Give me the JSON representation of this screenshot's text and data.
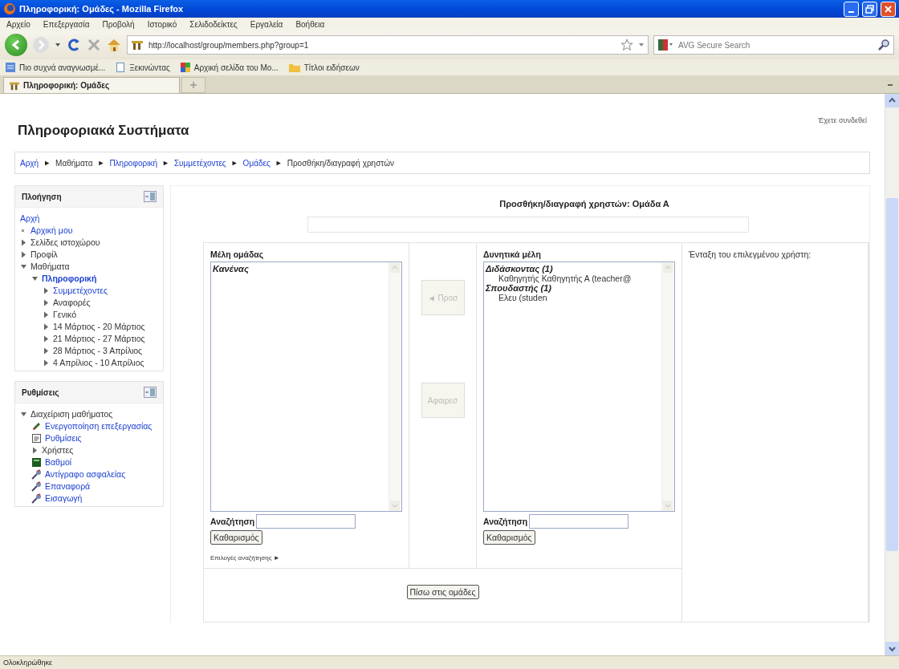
{
  "window": {
    "title": "Πληροφορική: Ομάδες - Mozilla Firefox"
  },
  "menu": [
    "Αρχείο",
    "Επεξεργασία",
    "Προβολή",
    "Ιστορικό",
    "Σελιδοδείκτες",
    "Εργαλεία",
    "Βοήθεια"
  ],
  "address_bar": {
    "value": "http://localhost/group/members.php?group=1"
  },
  "search": {
    "placeholder": "AVG Secure Search"
  },
  "bookmarks": [
    {
      "label": "Πιο συχνά αναγνωσμέ...",
      "kind": "smart"
    },
    {
      "label": "Ξεκινώντας",
      "kind": "page"
    },
    {
      "label": "Αρχική σελίδα του Mo...",
      "kind": "tiles"
    },
    {
      "label": "Τίτλοι ειδήσεων",
      "kind": "folder"
    }
  ],
  "tabs": [
    {
      "label": "Πληροφορική: Ομάδες",
      "selected": true
    }
  ],
  "site": {
    "title": "Πληροφοριακά Συστήματα",
    "login_info": "Έχετε συνδεθεί"
  },
  "breadcrumb": [
    {
      "label": "Αρχή",
      "kind": "link"
    },
    {
      "label": "►",
      "kind": "separator"
    },
    {
      "label": "Μαθήματα",
      "kind": "text"
    },
    {
      "label": "►",
      "kind": "separator"
    },
    {
      "label": "Πληροφορική",
      "kind": "link"
    },
    {
      "label": "►",
      "kind": "separator"
    },
    {
      "label": "Συμμετέχοντες",
      "kind": "link"
    },
    {
      "label": "►",
      "kind": "separator"
    },
    {
      "label": "Ομάδες",
      "kind": "link"
    },
    {
      "label": "►",
      "kind": "separator"
    },
    {
      "label": "Προσθήκη/διαγραφή χρηστών",
      "kind": "text"
    }
  ],
  "navigation": {
    "title": "Πλοήγηση",
    "items": [
      {
        "label": "Αρχή",
        "link": true,
        "kind": "plain"
      },
      {
        "label": "Αρχική μου",
        "link": true,
        "kind": "bullet"
      },
      {
        "label": "Σελίδες ιστοχώρου",
        "link": false,
        "kind": "arrow",
        "expanded": false
      },
      {
        "label": "Προφίλ",
        "link": false,
        "kind": "arrow",
        "expanded": false
      },
      {
        "label": "Μαθήματα",
        "link": false,
        "kind": "arrow",
        "expanded": true,
        "children": [
          {
            "label": "Πληροφορική",
            "current": true,
            "kind": "arrow",
            "expanded": true,
            "children": [
              {
                "label": "Συμμετέχοντες",
                "link": true,
                "kind": "arrow",
                "expanded": false
              },
              {
                "label": "Αναφορές",
                "link": false,
                "kind": "arrow",
                "expanded": false
              },
              {
                "label": "Γενικό",
                "link": false,
                "kind": "arrow",
                "expanded": false
              },
              {
                "label": "14 Μάρτιος - 20 Μάρτιος",
                "link": false,
                "kind": "arrow",
                "expanded": false
              },
              {
                "label": "21 Μάρτιος - 27 Μάρτιος",
                "link": false,
                "kind": "arrow",
                "expanded": false
              },
              {
                "label": "28 Μάρτιος - 3 Απρίλιος",
                "link": false,
                "kind": "arrow",
                "expanded": false
              },
              {
                "label": "4 Απρίλιος - 10 Απρίλιος",
                "link": false,
                "kind": "arrow",
                "expanded": false
              }
            ]
          }
        ]
      }
    ]
  },
  "settings": {
    "title": "Ρυθμίσεις",
    "items": [
      {
        "label": "Διαχείριση μαθήματος",
        "link": false,
        "kind": "arrow",
        "expanded": true,
        "children": [
          {
            "label": "Ενεργοποίηση επεξεργασίας",
            "link": true,
            "kind": "pencil"
          },
          {
            "label": "Ρυθμίσεις",
            "link": true,
            "kind": "document"
          },
          {
            "label": "Χρήστες",
            "link": false,
            "kind": "arrow",
            "expanded": false
          },
          {
            "label": "Βαθμοί",
            "link": true,
            "kind": "grades"
          },
          {
            "label": "Αντίγραφο ασφαλείας",
            "link": true,
            "kind": "tool"
          },
          {
            "label": "Επαναφορά",
            "link": true,
            "kind": "tool"
          },
          {
            "label": "Εισαγωγή",
            "link": true,
            "kind": "tool"
          }
        ]
      }
    ]
  },
  "main": {
    "heading": "Προσθήκη/διαγραφή χρηστών: Ομάδα Α",
    "members": {
      "label": "Μέλη ομάδας",
      "groups": [
        {
          "label": "Κανένας"
        }
      ],
      "search_label": "Αναζήτηση",
      "clear_button": "Καθαρισμός",
      "search_options": "Επιλογές αναζήτησης ►"
    },
    "add_button": {
      "label": "◄ Προσ",
      "disabled": true
    },
    "remove_button": {
      "label": "Αφαιρεσ",
      "disabled": true
    },
    "potential": {
      "label": "Δυνητικά μέλη",
      "groups": [
        {
          "label": "Διδάσκοντας (1)",
          "options": [
            {
              "name": "Καθηγητής Καθηγητής Α",
              "email": "(teacher@"
            }
          ]
        },
        {
          "label": "Σπουδαστής (1)",
          "options": [
            {
              "name": "Ελευ",
              "email": "(studen"
            }
          ]
        }
      ],
      "search_label": "Αναζήτηση",
      "clear_button": "Καθαρισμός"
    },
    "info": "Ένταξη του επιλεγμένου χρήστη:",
    "back_button": "Πίσω στις ομάδες"
  },
  "status_bar": "Ολοκληρώθηκε"
}
